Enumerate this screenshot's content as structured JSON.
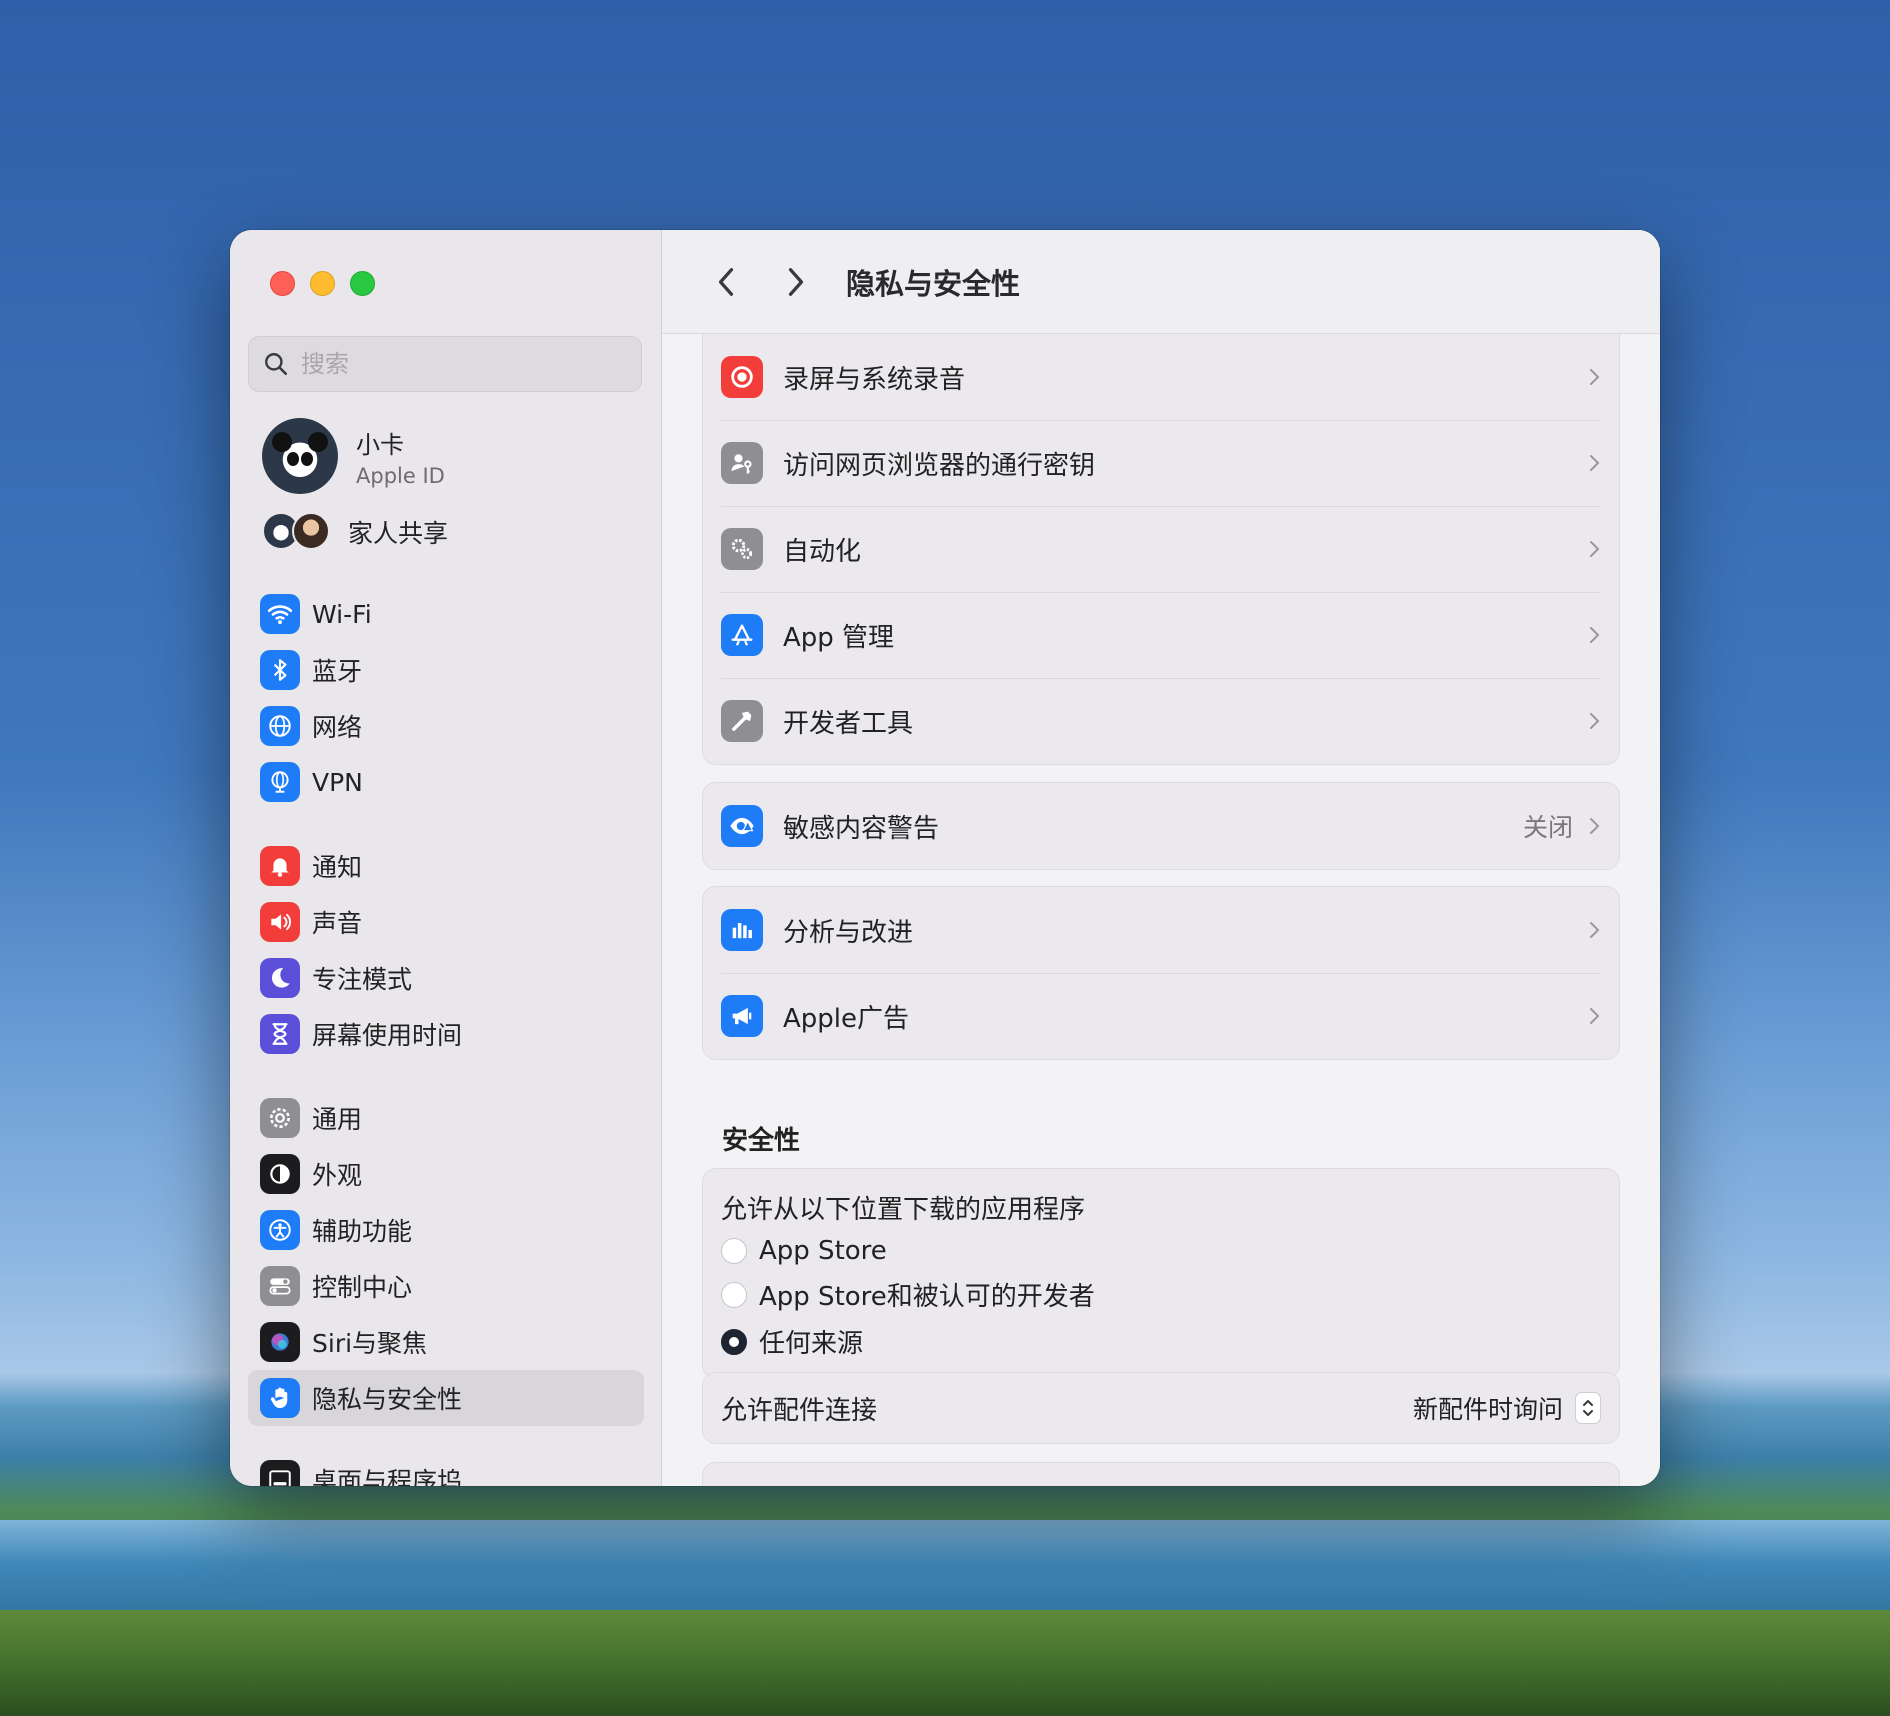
{
  "window": {
    "title": "隐私与安全性"
  },
  "sidebar": {
    "search_placeholder": "搜索",
    "account": {
      "name": "小卡",
      "subtitle": "Apple ID"
    },
    "family": {
      "label": "家人共享"
    },
    "groups": [
      [
        {
          "label": "Wi-Fi",
          "icon": "wifi-icon",
          "color": "#1e7cf6"
        },
        {
          "label": "蓝牙",
          "icon": "bluetooth-icon",
          "color": "#1e7cf6"
        },
        {
          "label": "网络",
          "icon": "globe-icon",
          "color": "#1e7cf6"
        },
        {
          "label": "VPN",
          "icon": "vpn-globe-icon",
          "color": "#1e7cf6"
        }
      ],
      [
        {
          "label": "通知",
          "icon": "bell-icon",
          "color": "#f23d3b"
        },
        {
          "label": "声音",
          "icon": "speaker-icon",
          "color": "#f23d3b"
        },
        {
          "label": "专注模式",
          "icon": "moon-icon",
          "color": "#5a4fd8"
        },
        {
          "label": "屏幕使用时间",
          "icon": "hourglass-icon",
          "color": "#5a4fd8"
        }
      ],
      [
        {
          "label": "通用",
          "icon": "gear-icon",
          "color": "#8e8e93"
        },
        {
          "label": "外观",
          "icon": "appearance-icon",
          "color": "#1c1c1e"
        },
        {
          "label": "辅助功能",
          "icon": "accessibility-icon",
          "color": "#1e7cf6"
        },
        {
          "label": "控制中心",
          "icon": "toggles-icon",
          "color": "#8e8e93"
        },
        {
          "label": "Siri与聚焦",
          "icon": "siri-icon",
          "color": "#1c1c1e"
        },
        {
          "label": "隐私与安全性",
          "icon": "hand-icon",
          "color": "#1e7cf6",
          "selected": true
        }
      ],
      [
        {
          "label": "桌面与程序坞",
          "icon": "dock-icon",
          "color": "#1c1c1e"
        }
      ]
    ]
  },
  "privacy_list_1": [
    {
      "label": "录屏与系统录音",
      "icon": "record-icon",
      "color": "#f23d3b"
    },
    {
      "label": "访问网页浏览器的通行密钥",
      "icon": "person-key-icon",
      "color": "#8e8e93"
    },
    {
      "label": "自动化",
      "icon": "gears-icon",
      "color": "#8e8e93"
    },
    {
      "label": "App 管理",
      "icon": "app-store-icon",
      "color": "#1e7cf6"
    },
    {
      "label": "开发者工具",
      "icon": "hammer-icon",
      "color": "#8e8e93"
    }
  ],
  "sensitive_content": {
    "label": "敏感内容警告",
    "value": "关闭",
    "icon": "eye-warning-icon",
    "color": "#1e7cf6"
  },
  "privacy_list_2": [
    {
      "label": "分析与改进",
      "icon": "bar-chart-icon",
      "color": "#1e7cf6"
    },
    {
      "label": "Apple广告",
      "icon": "megaphone-icon",
      "color": "#1e7cf6"
    }
  ],
  "security": {
    "title": "安全性",
    "download_label": "允许从以下位置下载的应用程序",
    "options": [
      {
        "label": "App Store",
        "checked": false
      },
      {
        "label": "App Store和被认可的开发者",
        "checked": false
      },
      {
        "label": "任何来源",
        "checked": true
      }
    ],
    "accessory": {
      "label": "允许配件连接",
      "value": "新配件时询问"
    }
  }
}
